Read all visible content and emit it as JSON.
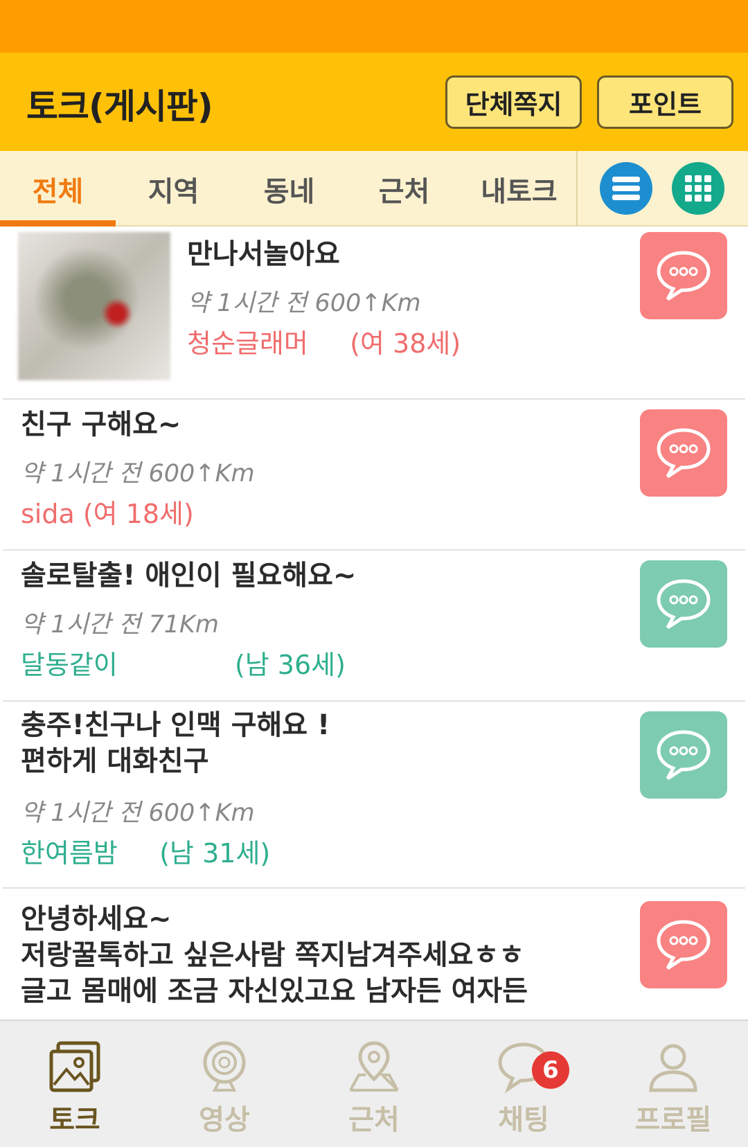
{
  "header": {
    "title": "토크(게시판)",
    "group_message_label": "단체쪽지",
    "point_label": "포인트"
  },
  "tabs": [
    {
      "label": "전체",
      "active": true
    },
    {
      "label": "지역",
      "active": false
    },
    {
      "label": "동네",
      "active": false
    },
    {
      "label": "근처",
      "active": false
    },
    {
      "label": "내토크",
      "active": false
    }
  ],
  "view_buttons": {
    "list_icon": "list-icon",
    "grid_icon": "grid-icon"
  },
  "posts": [
    {
      "title": "만나서놀아요",
      "meta": "약 1시간 전  600↑Km",
      "author": "청순글래머     (여 38세)",
      "gender": "f",
      "has_thumbnail": true
    },
    {
      "title": "친구 구해요~",
      "meta": "약 1시간 전  600↑Km",
      "author": "sida (여 18세)",
      "gender": "f",
      "has_thumbnail": false
    },
    {
      "title": "솔로탈출! 애인이 필요해요~",
      "meta": "약 1시간 전  71Km",
      "author": "달동같이              (남 36세)",
      "gender": "m",
      "has_thumbnail": false
    },
    {
      "title": "충주!친구나 인맥 구해요 !\n편하게 대화친구",
      "meta": "약 1시간 전  600↑Km",
      "author": "한여름밤     (남 31세)",
      "gender": "m",
      "has_thumbnail": false
    },
    {
      "title": "안녕하세요~\n저랑꿀톡하고 싶은사람 쪽지남겨주세요ㅎㅎ\n글고 몸매에 조금 자신있고요 남자든 여자든",
      "meta": "",
      "author": "",
      "gender": "f",
      "has_thumbnail": false
    }
  ],
  "colors": {
    "status_bar": "#ff9d00",
    "header": "#ffc107",
    "tab_active": "#f07a10",
    "female": "#f06c6c",
    "male": "#2eae8e",
    "chat_female": "#f98282",
    "chat_male": "#7dcbb0",
    "badge": "#e53935"
  },
  "bottom_nav": [
    {
      "label": "토크",
      "icon": "photo-gallery-icon",
      "active": true
    },
    {
      "label": "영상",
      "icon": "webcam-icon",
      "active": false
    },
    {
      "label": "근처",
      "icon": "map-pin-icon",
      "active": false
    },
    {
      "label": "채팅",
      "icon": "chat-bubble-icon",
      "active": false,
      "badge": "6"
    },
    {
      "label": "프로필",
      "icon": "person-icon",
      "active": false
    }
  ]
}
